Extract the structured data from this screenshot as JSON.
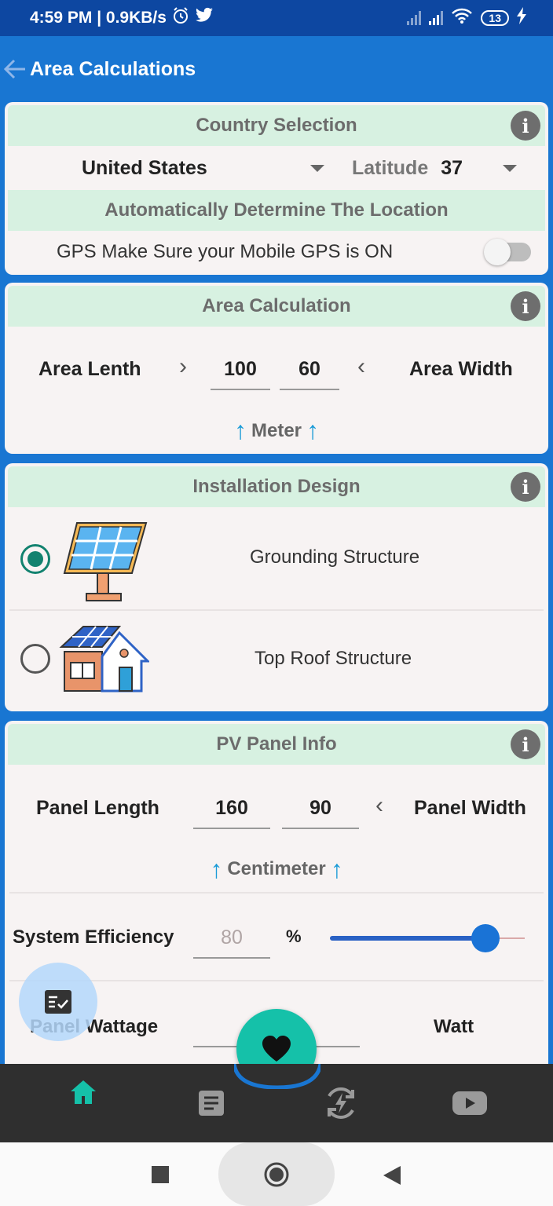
{
  "status_bar": {
    "time_speed": "4:59 PM | 0.9KB/s",
    "battery": "13"
  },
  "app_bar": {
    "title": "Area Calculations"
  },
  "country_card": {
    "header": "Country Selection",
    "country": "United States",
    "latitude_label": "Latitude",
    "latitude_value": "37",
    "auto_header": "Automatically Determine The Location",
    "gps_text": "GPS Make Sure your Mobile GPS is ON",
    "gps_enabled": false
  },
  "area_card": {
    "header": "Area Calculation",
    "length_label": "Area Lenth",
    "length_value": "100",
    "width_value": "60",
    "width_label": "Area Width",
    "unit": "Meter"
  },
  "design_card": {
    "header": "Installation Design",
    "options": [
      {
        "label": "Grounding Structure",
        "selected": true,
        "icon": "solar-panel-icon"
      },
      {
        "label": "Top Roof Structure",
        "selected": false,
        "icon": "house-solar-icon"
      }
    ]
  },
  "pv_card": {
    "header": "PV Panel Info",
    "length_label": "Panel Length",
    "length_value": "160",
    "width_value": "90",
    "width_label": "Panel Width",
    "unit": "Centimeter",
    "efficiency_label": "System Efficiency",
    "efficiency_value": "80",
    "efficiency_unit": "%",
    "efficiency_slider_fraction": 0.8,
    "wattage_label": "Panel Wattage",
    "wattage_unit": "Watt"
  },
  "colors": {
    "primary": "#1976d2",
    "status_bar": "#0d47a1",
    "card_header": "#d7f1e1",
    "accent_teal": "#15c1a9",
    "radio_selected": "#12826f"
  },
  "bottom_nav": {
    "items": [
      "home-icon",
      "document-icon",
      "energy-refresh-icon",
      "youtube-icon"
    ],
    "active": "home-icon"
  }
}
